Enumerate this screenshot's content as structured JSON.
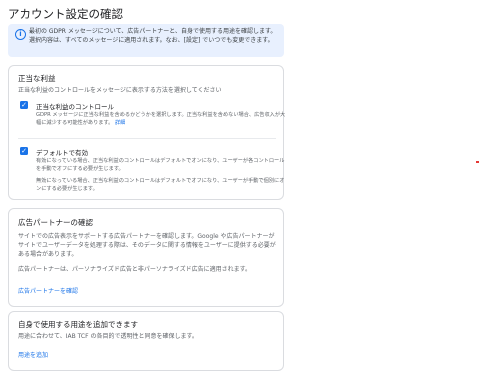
{
  "page": {
    "title": "アカウント設定の確認"
  },
  "info_banner": {
    "icon": "info-icon",
    "text": "最初の GDPR メッセージについて、広告パートナーと、自身で使用する用途を確認します。選択内容は、すべてのメッセージに適用されます。なお、[設定] でいつでも変更できます。"
  },
  "legitimate_interest": {
    "title": "正当な利益",
    "subtitle": "正当な利益のコントロールをメッセージに表示する方法を選択してください",
    "options": [
      {
        "label": "正当な利益のコントロール",
        "checked": true,
        "desc": "GDPR メッセージに正当な利益を含めるかどうかを選択します。正当な利益を含めない場合、広告収入が大幅に減少する可能性があります。",
        "link": "詳細"
      },
      {
        "label": "デフォルトで有効",
        "checked": true,
        "desc1": "有効になっている場合、正当な利益のコントロールはデフォルトでオンになり、ユーザーが各コントロールを手動でオフにする必要が生じます。",
        "desc2": "無効になっている場合、正当な利益のコントロールはデフォルトでオフになり、ユーザーが手動で個別にオンにする必要が生じます。"
      }
    ]
  },
  "partners": {
    "title": "広告パートナーの確認",
    "para1": "サイトでの広告表示をサポートする広告パートナーを確認します。Google や広告パートナーがサイトでユーザーデータを処理する際は、そのデータに関する情報をユーザーに提供する必要がある場合があります。",
    "para2": "広告パートナーは、パーソナライズド広告と非パーソナライズド広告に適用されます。",
    "link": "広告パートナーを確認"
  },
  "purposes": {
    "title": "自身で使用する用途を追加できます",
    "subtitle": "用途に合わせて、IAB TCF の各目的で透明性と同意を確保します。",
    "link": "用途を追加"
  },
  "colors": {
    "accent": "#1a73e8",
    "banner_bg": "#e8f0fe",
    "border": "#dadce0"
  }
}
